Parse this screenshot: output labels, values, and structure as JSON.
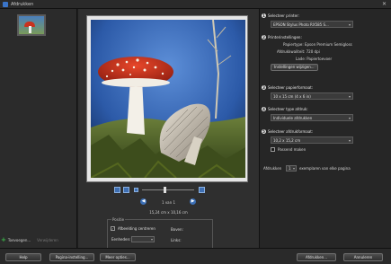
{
  "window": {
    "title": "Afdrukken",
    "close_glyph": "✕"
  },
  "left_panel": {
    "add_label": "Toevoegen...",
    "remove_label": "Verwijderen"
  },
  "preview": {
    "page_label": "1 van 1",
    "size_label": "15,24 cm x 10,16 cm",
    "position": {
      "legend": "Positie",
      "center_label": "Afbeelding centreren",
      "center_checked": true,
      "units_label": "Eenheden:",
      "units_value": "",
      "top_label": "Boven:",
      "left_label": "Links:"
    }
  },
  "settings": {
    "step1": {
      "num": "1",
      "label": "Selecteer printer:",
      "value": "EPSON Stylus Photo RX585 S..."
    },
    "step2": {
      "num": "2",
      "label": "Printerinstellingen:",
      "paper_type": "Papiertype: Epson Premium Semigloss",
      "print_quality": "Afdrukkwaliteit: 720 dpi",
      "tray": "Lade: Papiertoevoer",
      "change_button": "Instellingen wijzigen..."
    },
    "step3": {
      "num": "3",
      "label": "Selecteer papierformaat:",
      "value": "10 x 15 cm (4 x 6 in)"
    },
    "step4": {
      "num": "4",
      "label": "Selecteer type afdruk:",
      "value": "Individuele afdrukken"
    },
    "step5": {
      "num": "5",
      "label": "Selecteer afdrukformaat:",
      "value": "10,2 x 15,2 cm",
      "crop_label": "Passend maken",
      "crop_checked": false
    },
    "copies": {
      "label": "Afdrukken",
      "value": "1",
      "suffix": "exemplaren van elke pagina"
    }
  },
  "buttons": {
    "help": "Help",
    "page_setup": "Pagina-instelling...",
    "more_options": "Meer opties...",
    "print": "Afdrukken...",
    "cancel": "Annuleren"
  },
  "colors": {
    "accent": "#3b6fb6",
    "mushroom_cap": "#c8321f",
    "sky": "#1d3d74"
  }
}
